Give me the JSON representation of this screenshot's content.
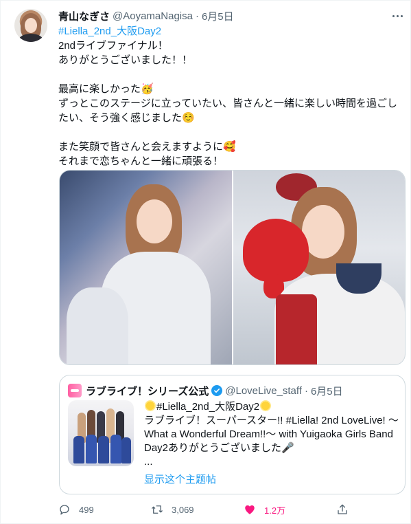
{
  "tweet": {
    "display_name": "青山なぎさ",
    "handle": "@AoyamaNagisa",
    "separator": "·",
    "date": "6月5日",
    "hashtag": "#Liella_2nd_大阪Day2",
    "lines": [
      "2ndライブファイナル！",
      "ありがとうございました！！",
      "",
      "最高に楽しかった🥳",
      "ずっとこのステージに立っていたい、皆さんと一緒に楽しい時間を過ごし",
      "たい、そう強く感じました☺️",
      "",
      "また笑顔で皆さんと会えますように🥰",
      "それまで恋ちゃんと一緒に頑張る！"
    ],
    "more_icon": "more-horizontal-icon"
  },
  "quote": {
    "name": "ラブライブ！シリーズ公式",
    "verified_icon": "verified-badge-icon",
    "handle": "@LoveLive_staff",
    "separator": "·",
    "date": "6月5日",
    "lines": [
      "#Liella_2nd_大阪Day2",
      "ラブライブ！スーパースター!! #Liella! 2nd LoveLive! 〜",
      "What a Wonderful Dream!!〜 with Yuigaoka Girls Band",
      "Day2ありがとうございました🎤",
      "..."
    ],
    "show_thread": "显示这个主题帖"
  },
  "actions": {
    "reply_count": "499",
    "retweet_count": "3,069",
    "like_count": "1.2万",
    "like_color": "#f91880",
    "accent_color": "#1d9bf0"
  }
}
